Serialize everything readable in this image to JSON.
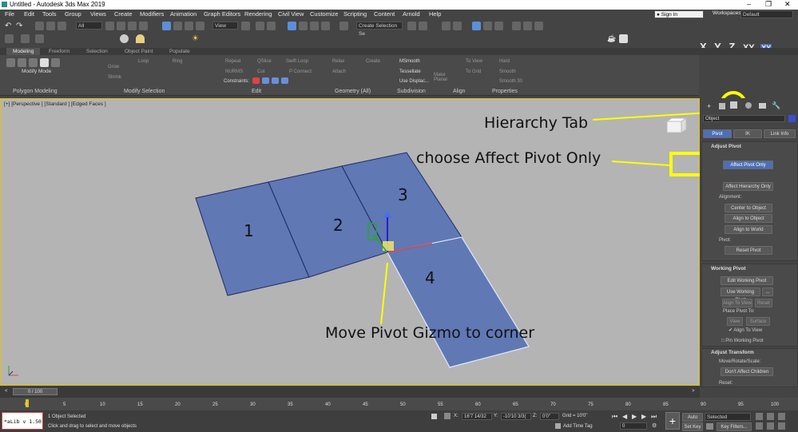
{
  "window": {
    "title": "Untitled - Autodesk 3ds Max 2019"
  },
  "menu": [
    "File",
    "Edit",
    "Tools",
    "Group",
    "Views",
    "Create",
    "Modifiers",
    "Animation",
    "Graph Editors",
    "Rendering",
    "Civil View",
    "Customize",
    "Scripting",
    "Content",
    "Arnold",
    "Help"
  ],
  "user": {
    "sign_in": "Sign In",
    "workspaces_label": "Workspaces:",
    "workspace": "Default"
  },
  "toolbar": {
    "filter": "All",
    "view": "View",
    "selection_set": "Create Selection Se",
    "axes": [
      "X",
      "Y",
      "Z",
      "XY"
    ],
    "axis_active": "XY"
  },
  "ribbon": {
    "tabs": [
      "Modeling",
      "Freeform",
      "Selection",
      "Object Paint",
      "Populate"
    ],
    "active_tab": "Modeling",
    "sections": [
      "Polygon Modeling",
      "Modify Selection",
      "Edit",
      "Geometry (All)",
      "Subdivision",
      "Align",
      "Properties"
    ],
    "mode": "Modify Mode",
    "grow": "Grow",
    "shrink": "Shrink",
    "loop": "Loop",
    "ring": "Ring",
    "repeat": "Repeat",
    "qslice": "QSlice",
    "swift_loop": "Swift Loop",
    "nurms": "NURMS",
    "cut": "Cut",
    "p_connect": "P Connect",
    "constraints": "Constraints:",
    "relax": "Relax",
    "create": "Create",
    "attach": "Attach",
    "msmooth": "MSmooth",
    "tessellate": "Tessellate",
    "use_displac": "Use Displac...",
    "make_planar": "Make Planar",
    "to_view": "To View",
    "to_grid": "To Grid",
    "hard": "Hard",
    "smooth": "Smooth",
    "smooth30": "Smooth 30"
  },
  "viewport": {
    "label": "[+] [Perspective ] [Standard ] [Edged Faces ]",
    "faces": [
      "1",
      "2",
      "3",
      "4"
    ]
  },
  "annotations": {
    "hierarchy": "Hierarchy Tab",
    "affect": "choose Affect Pivot Only",
    "move": "Move Pivot Gizmo to corner",
    "colors": {
      "highlight": "#ffff00",
      "faces": "#6078b4",
      "edge": "#1e2a6a"
    }
  },
  "command_panel": {
    "object_name": "Object",
    "tabs": [
      "Pivot",
      "IK",
      "Link Info"
    ],
    "active_tab": "Pivot",
    "adjust_pivot": "Adjust Pivot",
    "affect_pivot_only": "Affect Pivot Only",
    "affect_hierarchy_only": "Affect Hierarchy Only",
    "alignment": "Alignment:",
    "center_to_object": "Center to Object",
    "align_to_object": "Align to Object",
    "align_to_world": "Align to World",
    "pivot_label": "Pivot:",
    "reset_pivot": "Reset Pivot",
    "working_pivot": "Working Pivot",
    "edit_working_pivot": "Edit Working Pivot",
    "use_working_pivot": "Use Working Pivot",
    "align_to_view": "Align To View",
    "reset": "Reset",
    "place_pivot_to": "Place Pivot To:",
    "view": "View",
    "surface": "Surface",
    "align_to_view_cb": "Align To View",
    "pin_working_pivot": "Pin Working Pivot",
    "adjust_transform": "Adjust Transform",
    "move_rotate_scale": "Move/Rotate/Scale:",
    "dont_affect_children": "Don't Affect Children",
    "reset2": "Reset:"
  },
  "timeline": {
    "frame": "0 / 100",
    "ticks": [
      "0",
      "5",
      "10",
      "15",
      "20",
      "25",
      "30",
      "35",
      "40",
      "45",
      "50",
      "55",
      "60",
      "65",
      "70",
      "75",
      "80",
      "85",
      "90",
      "95",
      "100"
    ]
  },
  "status": {
    "maxscript": "*aLib v 1.50",
    "selected": "1 Object Selected",
    "prompt": "Click and drag to select and move objects",
    "x_label": "X:",
    "x_val": "16'7 14/32",
    "y_label": "Y:",
    "y_val": "-10'10 3/3(",
    "z_label": "Z:",
    "z_val": "0'0\"",
    "grid": "Grid = 10'0\"",
    "add_time_tag": "Add Time Tag",
    "frame_field": "0",
    "auto_key": "Auto Key",
    "set_key": "Set Key",
    "selected_dd": "Selected",
    "key_filters": "Key Filters..."
  }
}
